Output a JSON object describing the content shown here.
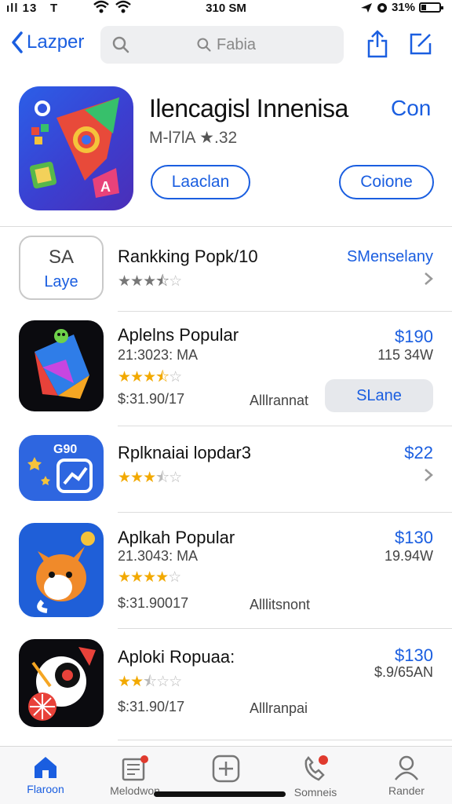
{
  "status": {
    "left": "ıll 13",
    "carrier": "T",
    "time": "310 SM",
    "battery": "31%"
  },
  "nav": {
    "back_label": "Lazper",
    "search_placeholder": "Fabia"
  },
  "featured": {
    "title": "Ilencagisl Innenisa",
    "link": "Con",
    "subtitle": "M-l7lA ★.32",
    "button_left": "Laaclan",
    "button_right": "Coione"
  },
  "rows": [
    {
      "icon_text_top": "SA",
      "icon_text_bottom": "Laye",
      "title": "Rankking Popk/10",
      "price": "SMenselany",
      "rating": 3.5
    },
    {
      "title": "Aplelns Popular",
      "sub": "21:3023: MA",
      "rating": 3.5,
      "price_line": "$:31.90/17",
      "extra": "Alllrannat",
      "price": "$190",
      "size": "115 34W",
      "button": "SLane"
    },
    {
      "icon_text": "G90",
      "title": "Rplknaiai lopdar3",
      "rating": 3,
      "price": "$22"
    },
    {
      "title": "Aplkah Popular",
      "sub": "21.3043: MA",
      "rating": 4,
      "price_line": "$:31.90017",
      "extra": "Alllitsnont",
      "price": "$130",
      "size": "19.94W"
    },
    {
      "title": "Aploki Ropuaa:",
      "rating": 2,
      "price_line": "$:31.90/17",
      "extra": "Alllranpai",
      "price": "$130",
      "size": "$.9/65AN"
    }
  ],
  "tabs": [
    {
      "label": "Flaroon",
      "icon": "home-icon",
      "active": true
    },
    {
      "label": "Melodwon",
      "icon": "newspaper-icon",
      "badge": true
    },
    {
      "label": "",
      "icon": "plus-square-icon"
    },
    {
      "label": "Somneis",
      "icon": "phone-icon",
      "badge": true
    },
    {
      "label": "Rander",
      "icon": "person-icon"
    }
  ],
  "colors": {
    "accent": "#1a5ee0",
    "star": "#f2a900",
    "badge": "#e03a2e"
  }
}
